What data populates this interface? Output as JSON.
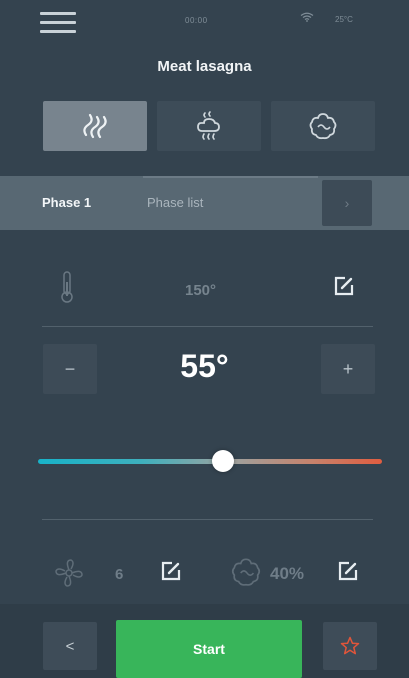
{
  "status": {
    "time": "00:00",
    "temp": "25°C",
    "wifi_icon": "wifi-icon"
  },
  "title": "Meat lasagna",
  "modes": [
    {
      "icon": "convection-heat-icon",
      "active": true
    },
    {
      "icon": "steam-icon",
      "active": false
    },
    {
      "icon": "combi-icon",
      "active": false
    }
  ],
  "phase": {
    "active_label": "Phase 1",
    "list_label": "Phase list",
    "next_icon": "chevron-right-icon"
  },
  "oven": {
    "set_temperature": "150°",
    "core_temperature": "55°",
    "slider_level": 0.54
  },
  "controls": {
    "minus_label": "−",
    "plus_label": "+"
  },
  "settings": {
    "fan_speed": "6",
    "humidity": "40%"
  },
  "footer": {
    "back_label": "<",
    "start_label": "Start",
    "favorite_icon": "star-icon"
  },
  "colors": {
    "background": "#34434f",
    "start": "#38b55a",
    "star": "#e0553a",
    "slider_start": "#18b3c9",
    "slider_end": "#e05d40"
  }
}
